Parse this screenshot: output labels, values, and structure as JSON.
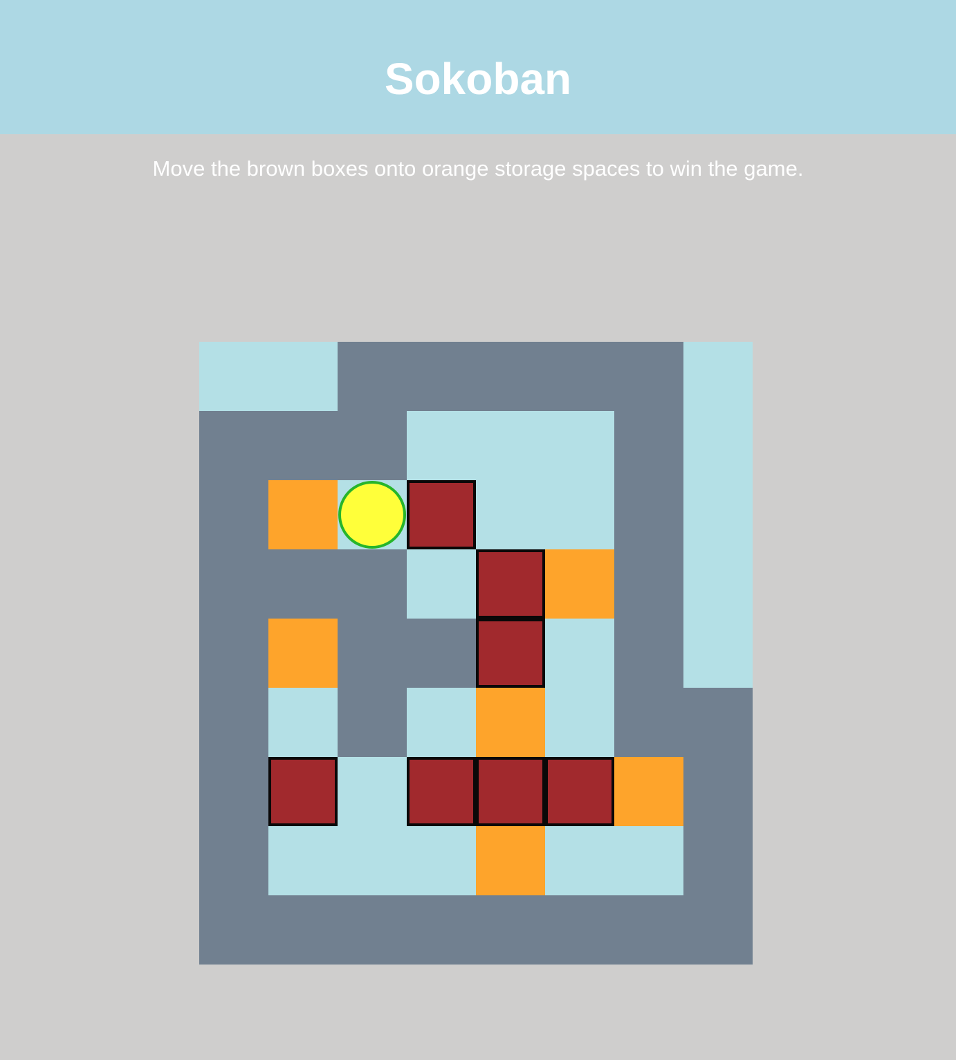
{
  "header": {
    "title": "Sokoban"
  },
  "instructions": "Move the brown boxes onto orange storage spaces to win the game.",
  "colors": {
    "header_bg": "#add8e4",
    "page_bg": "#cfcecd",
    "wall": "#718090",
    "floor": "#b4e0e6",
    "goal": "#fea42b",
    "box": "#a1292d",
    "box_border": "#0a0808",
    "player_fill": "#ffff3a",
    "player_border": "#27b52b"
  },
  "board": {
    "cols": 8,
    "rows": 9,
    "legend": {
      "W": "wall",
      "F": "floor",
      "G": "goal"
    },
    "tiles": [
      "FFWWWWWF",
      "WWWFFFWF",
      "WGFFFFWF",
      "WWWFFGWF",
      "WGWWFFWF",
      "WFWFGFWW",
      "WFFFFFGW",
      "WFFFGFFW",
      "WWWWWWWW"
    ],
    "boxes": [
      {
        "row": 2,
        "col": 3
      },
      {
        "row": 3,
        "col": 4
      },
      {
        "row": 4,
        "col": 4
      },
      {
        "row": 6,
        "col": 1
      },
      {
        "row": 6,
        "col": 3
      },
      {
        "row": 6,
        "col": 4
      },
      {
        "row": 6,
        "col": 5
      }
    ],
    "player": {
      "row": 2,
      "col": 2
    }
  }
}
